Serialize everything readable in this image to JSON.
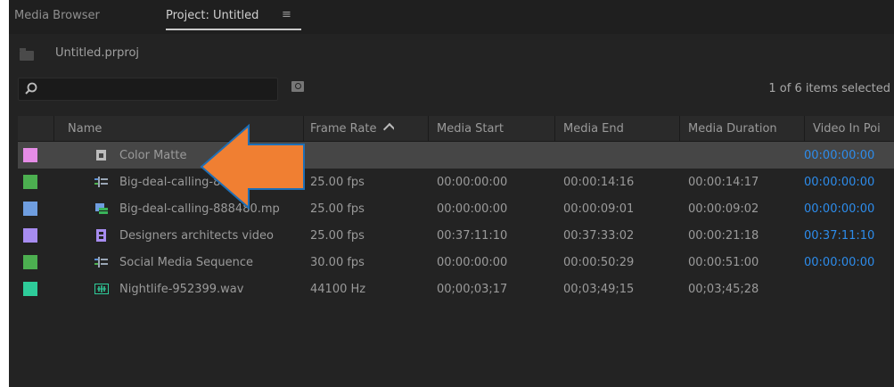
{
  "tabs": [
    {
      "label": "Media Browser"
    },
    {
      "label": "Project: Untitled"
    }
  ],
  "path": "Untitled.prproj",
  "search": {
    "placeholder": ""
  },
  "items_selected": "1 of 6 items selected",
  "columns": [
    "Name",
    "Frame Rate",
    "Media Start",
    "Media End",
    "Media Duration",
    "Video In Poi"
  ],
  "sort": {
    "column": "Frame Rate",
    "direction": "ascending"
  },
  "rows": [
    {
      "name": "Color Matte",
      "frame_rate": "",
      "media_start": "",
      "media_end": "",
      "media_duration": "",
      "video_in": "00:00:00:00",
      "swatch": "#e58ce6",
      "icon": "color-matte-icon",
      "selected": true
    },
    {
      "name": "Big-deal-calling-888480",
      "frame_rate": "25.00 fps",
      "media_start": "00:00:00:00",
      "media_end": "00:00:14:16",
      "media_duration": "00:00:14:17",
      "video_in": "00:00:00:00",
      "swatch": "#4caf50",
      "icon": "sequence-icon",
      "selected": false
    },
    {
      "name": "Big-deal-calling-888480.mp",
      "frame_rate": "25.00 fps",
      "media_start": "00:00:00:00",
      "media_end": "00:00:09:01",
      "media_duration": "00:00:09:02",
      "video_in": "00:00:00:00",
      "swatch": "#6f9ee0",
      "icon": "clip-icon",
      "selected": false
    },
    {
      "name": "Designers architects video",
      "frame_rate": "25.00 fps",
      "media_start": "00:37:11:10",
      "media_end": "00:37:33:02",
      "media_duration": "00:00:21:18",
      "video_in": "00:37:11:10",
      "swatch": "#a78cf0",
      "icon": "video-icon",
      "selected": false
    },
    {
      "name": "Social Media Sequence",
      "frame_rate": "30.00 fps",
      "media_start": "00:00:00:00",
      "media_end": "00:00:50:29",
      "media_duration": "00:00:51:00",
      "video_in": "00:00:00:00",
      "swatch": "#4caf50",
      "icon": "sequence-icon",
      "selected": false
    },
    {
      "name": "Nightlife-952399.wav",
      "frame_rate": "44100 Hz",
      "media_start": "00;00;03;17",
      "media_end": "00;03;49;15",
      "media_duration": "00;03;45;28",
      "video_in": "",
      "swatch": "#2ecc9a",
      "icon": "audio-icon",
      "selected": false
    }
  ],
  "colors": {
    "accent_timecode": "#2d8ceb",
    "arrow": "#f07f32"
  }
}
